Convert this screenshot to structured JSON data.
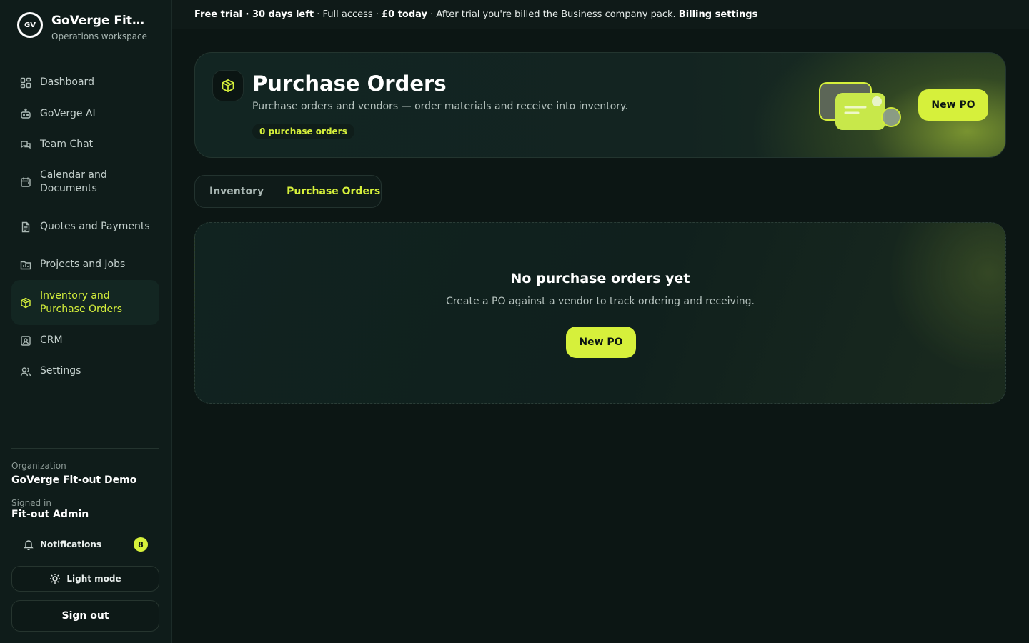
{
  "brand": {
    "logo_text": "GV",
    "name": "GoVerge Fitout Demo",
    "subtitle": "Operations workspace"
  },
  "sidebar": {
    "items": [
      {
        "label": "Dashboard",
        "icon": "dashboard-icon"
      },
      {
        "label": "GoVerge AI",
        "icon": "robot-icon"
      },
      {
        "label": "Team Chat",
        "icon": "chat-icon"
      },
      {
        "label": "Calendar and Documents",
        "icon": "calendar-icon"
      },
      {
        "label": "Quotes and Payments",
        "icon": "document-icon"
      },
      {
        "label": "Projects and Jobs",
        "icon": "folder-icon"
      },
      {
        "label": "Inventory and Purchase Orders",
        "icon": "box-icon",
        "active": true
      },
      {
        "label": "CRM",
        "icon": "contact-card-icon"
      },
      {
        "label": "Settings",
        "icon": "users-icon"
      }
    ],
    "organization_label": "Organization",
    "organization_value": "GoVerge Fit-out Demo",
    "signed_in_label": "Signed in",
    "signed_in_value": "Fit-out Admin",
    "notifications_label": "Notifications",
    "notifications_count": "8",
    "light_mode_label": "Light mode",
    "sign_out_label": "Sign out"
  },
  "trial_banner": {
    "trial": "Free trial",
    "sep1": " · ",
    "days_left": "30 days left",
    "access": " · Full access · ",
    "price": "£0 today",
    "billing_note": " · After trial you're billed the Business company pack. ",
    "billing_link": "Billing settings"
  },
  "header": {
    "title": "Purchase Orders",
    "subtitle": "Purchase orders and vendors — order materials and receive into inventory.",
    "count_chip": "0 purchase orders",
    "new_button": "New PO"
  },
  "tabs": [
    {
      "label": "Inventory",
      "active": false
    },
    {
      "label": "Purchase Orders",
      "active": true
    }
  ],
  "empty_state": {
    "title": "No purchase orders yet",
    "subtitle": "Create a PO against a vendor to track ordering and receiving.",
    "button": "New PO"
  },
  "colors": {
    "accent": "#d6f03b",
    "background": "#0c1614",
    "sidebar": "#0f1c1a"
  }
}
